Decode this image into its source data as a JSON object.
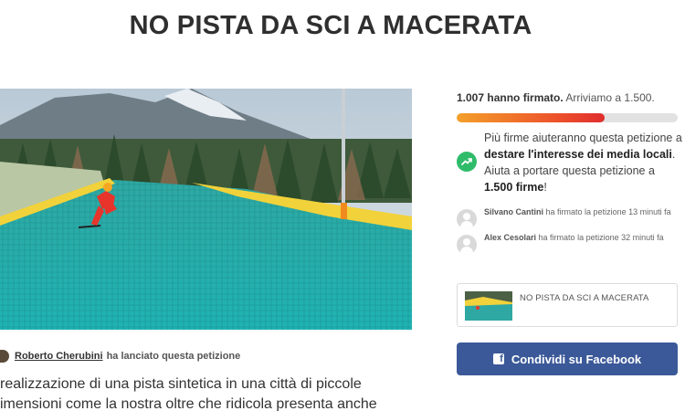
{
  "petition": {
    "title": "NO PISTA DA SCI A MACERATA",
    "author_name": "Roberto Cherubini",
    "author_action": "ha lanciato questa petizione",
    "body_line1": "realizzazione di una pista sintetica in una città di piccole",
    "body_line2": "imensioni come la nostra oltre che ridicola presenta anche"
  },
  "sidebar": {
    "signature_count": "1.007 hanno firmato.",
    "signature_goal": "Arriviamo a 1.500.",
    "progress_fraction": 0.67,
    "goal_message": {
      "part1": "Più firme aiuteranno questa petizione a ",
      "bold1": "destare l'interesse dei media locali",
      "part2": ". Aiuta a portare questa petizione a ",
      "bold2": "1.500 firme",
      "part3": "!"
    },
    "recent_signers": [
      {
        "name": "Silvano Cantini",
        "action": "ha firmato la petizione 13 minuti fa"
      },
      {
        "name": "Alex Cesolari",
        "action": "ha firmato la petizione 32 minuti fa"
      }
    ],
    "share_card_title": "NO PISTA DA SCI A MACERATA",
    "facebook_button_label": "Condividi su Facebook"
  },
  "icons": {
    "trend": "trending-up-icon",
    "facebook": "facebook-icon",
    "avatar": "user-avatar-icon"
  },
  "colors": {
    "facebook_blue": "#3b5998",
    "progress_start": "#f4a02a",
    "progress_end": "#e02e2e",
    "trend_green": "#2fbc6a"
  }
}
